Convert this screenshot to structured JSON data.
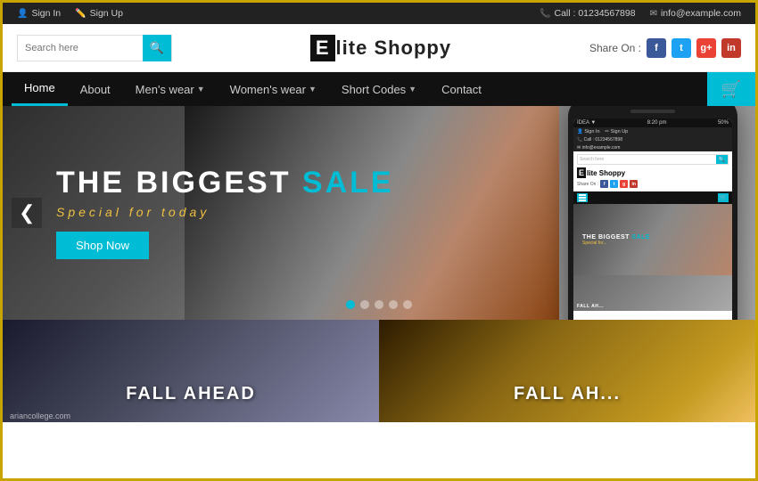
{
  "topbar": {
    "signin": "Sign In",
    "signup": "Sign Up",
    "phone_label": "Call : 01234567898",
    "email_label": "info@example.com"
  },
  "header": {
    "search_placeholder": "Search here",
    "logo_letter": "E",
    "logo_text": "lite Shoppy",
    "share_label": "Share On :"
  },
  "navbar": {
    "items": [
      {
        "label": "Home",
        "active": true
      },
      {
        "label": "About",
        "active": false
      },
      {
        "label": "Men's wear",
        "has_arrow": true,
        "active": false
      },
      {
        "label": "Women's wear",
        "has_arrow": true,
        "active": false
      },
      {
        "label": "Short Codes",
        "has_arrow": true,
        "active": false
      },
      {
        "label": "Contact",
        "active": false
      }
    ]
  },
  "hero": {
    "title_prefix": "THE BIGGEST ",
    "title_sale": "SALE",
    "subtitle": "Special for today",
    "btn_label": "Shop Now",
    "dots": [
      true,
      false,
      false,
      false,
      false
    ]
  },
  "phone": {
    "status_left": "IDEA ▼",
    "status_right": "50%",
    "time": "8:20 pm",
    "signin": "Sign In",
    "signup": "Sign Up",
    "phone_label": "Call : 01234567898",
    "email_label": "info@example.com",
    "search_placeholder": "Search here",
    "logo_letter": "E",
    "logo_text": "lite Shoppy",
    "share_label": "Share On :",
    "hero_title": "THE BIGGEST ",
    "hero_sale": "SALE",
    "hero_sub": "Special for..."
  },
  "cards": [
    {
      "label": "FALL AHEAD"
    },
    {
      "label": "FALL AH..."
    }
  ],
  "website_label": "ariancollege.com"
}
